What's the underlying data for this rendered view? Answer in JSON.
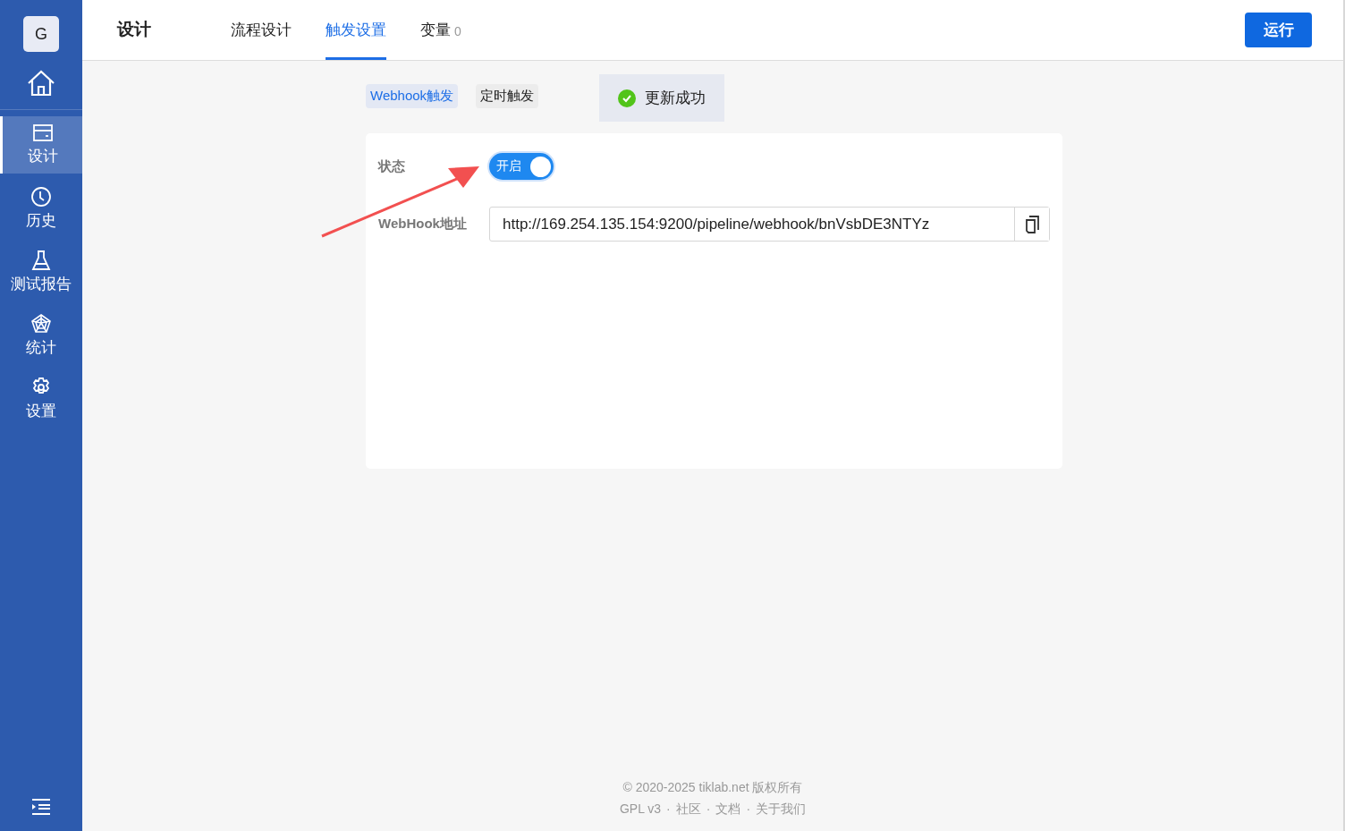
{
  "sidebar": {
    "logo": "G",
    "items": [
      {
        "label": "设计",
        "selected": true
      },
      {
        "label": "历史",
        "selected": false
      },
      {
        "label": "测试报告",
        "selected": false
      },
      {
        "label": "统计",
        "selected": false
      },
      {
        "label": "设置",
        "selected": false
      }
    ]
  },
  "header": {
    "title": "设计",
    "tabs": [
      {
        "label": "流程设计",
        "selected": false
      },
      {
        "label": "触发设置",
        "selected": true
      },
      {
        "label": "变量",
        "count": "0",
        "selected": false
      }
    ],
    "run_button": "运行"
  },
  "trigger_tabs": [
    {
      "label": "Webhook触发",
      "selected": true
    },
    {
      "label": "定时触发",
      "selected": false
    }
  ],
  "toast": {
    "kind": "success",
    "message": "更新成功"
  },
  "form": {
    "status": {
      "label": "状态",
      "on": true,
      "text": "开启"
    },
    "webhook": {
      "label": "WebHook地址",
      "value": "http://169.254.135.154:9200/pipeline/webhook/bnVsbDE3NTYz"
    }
  },
  "footer": {
    "copyright": "© 2020-2025 tiklab.net 版权所有",
    "links": [
      {
        "label": "GPL v3",
        "separator": "·"
      },
      {
        "label": "社区",
        "separator": "·"
      },
      {
        "label": "文档",
        "separator": "·"
      },
      {
        "label": "关于我们"
      }
    ]
  }
}
